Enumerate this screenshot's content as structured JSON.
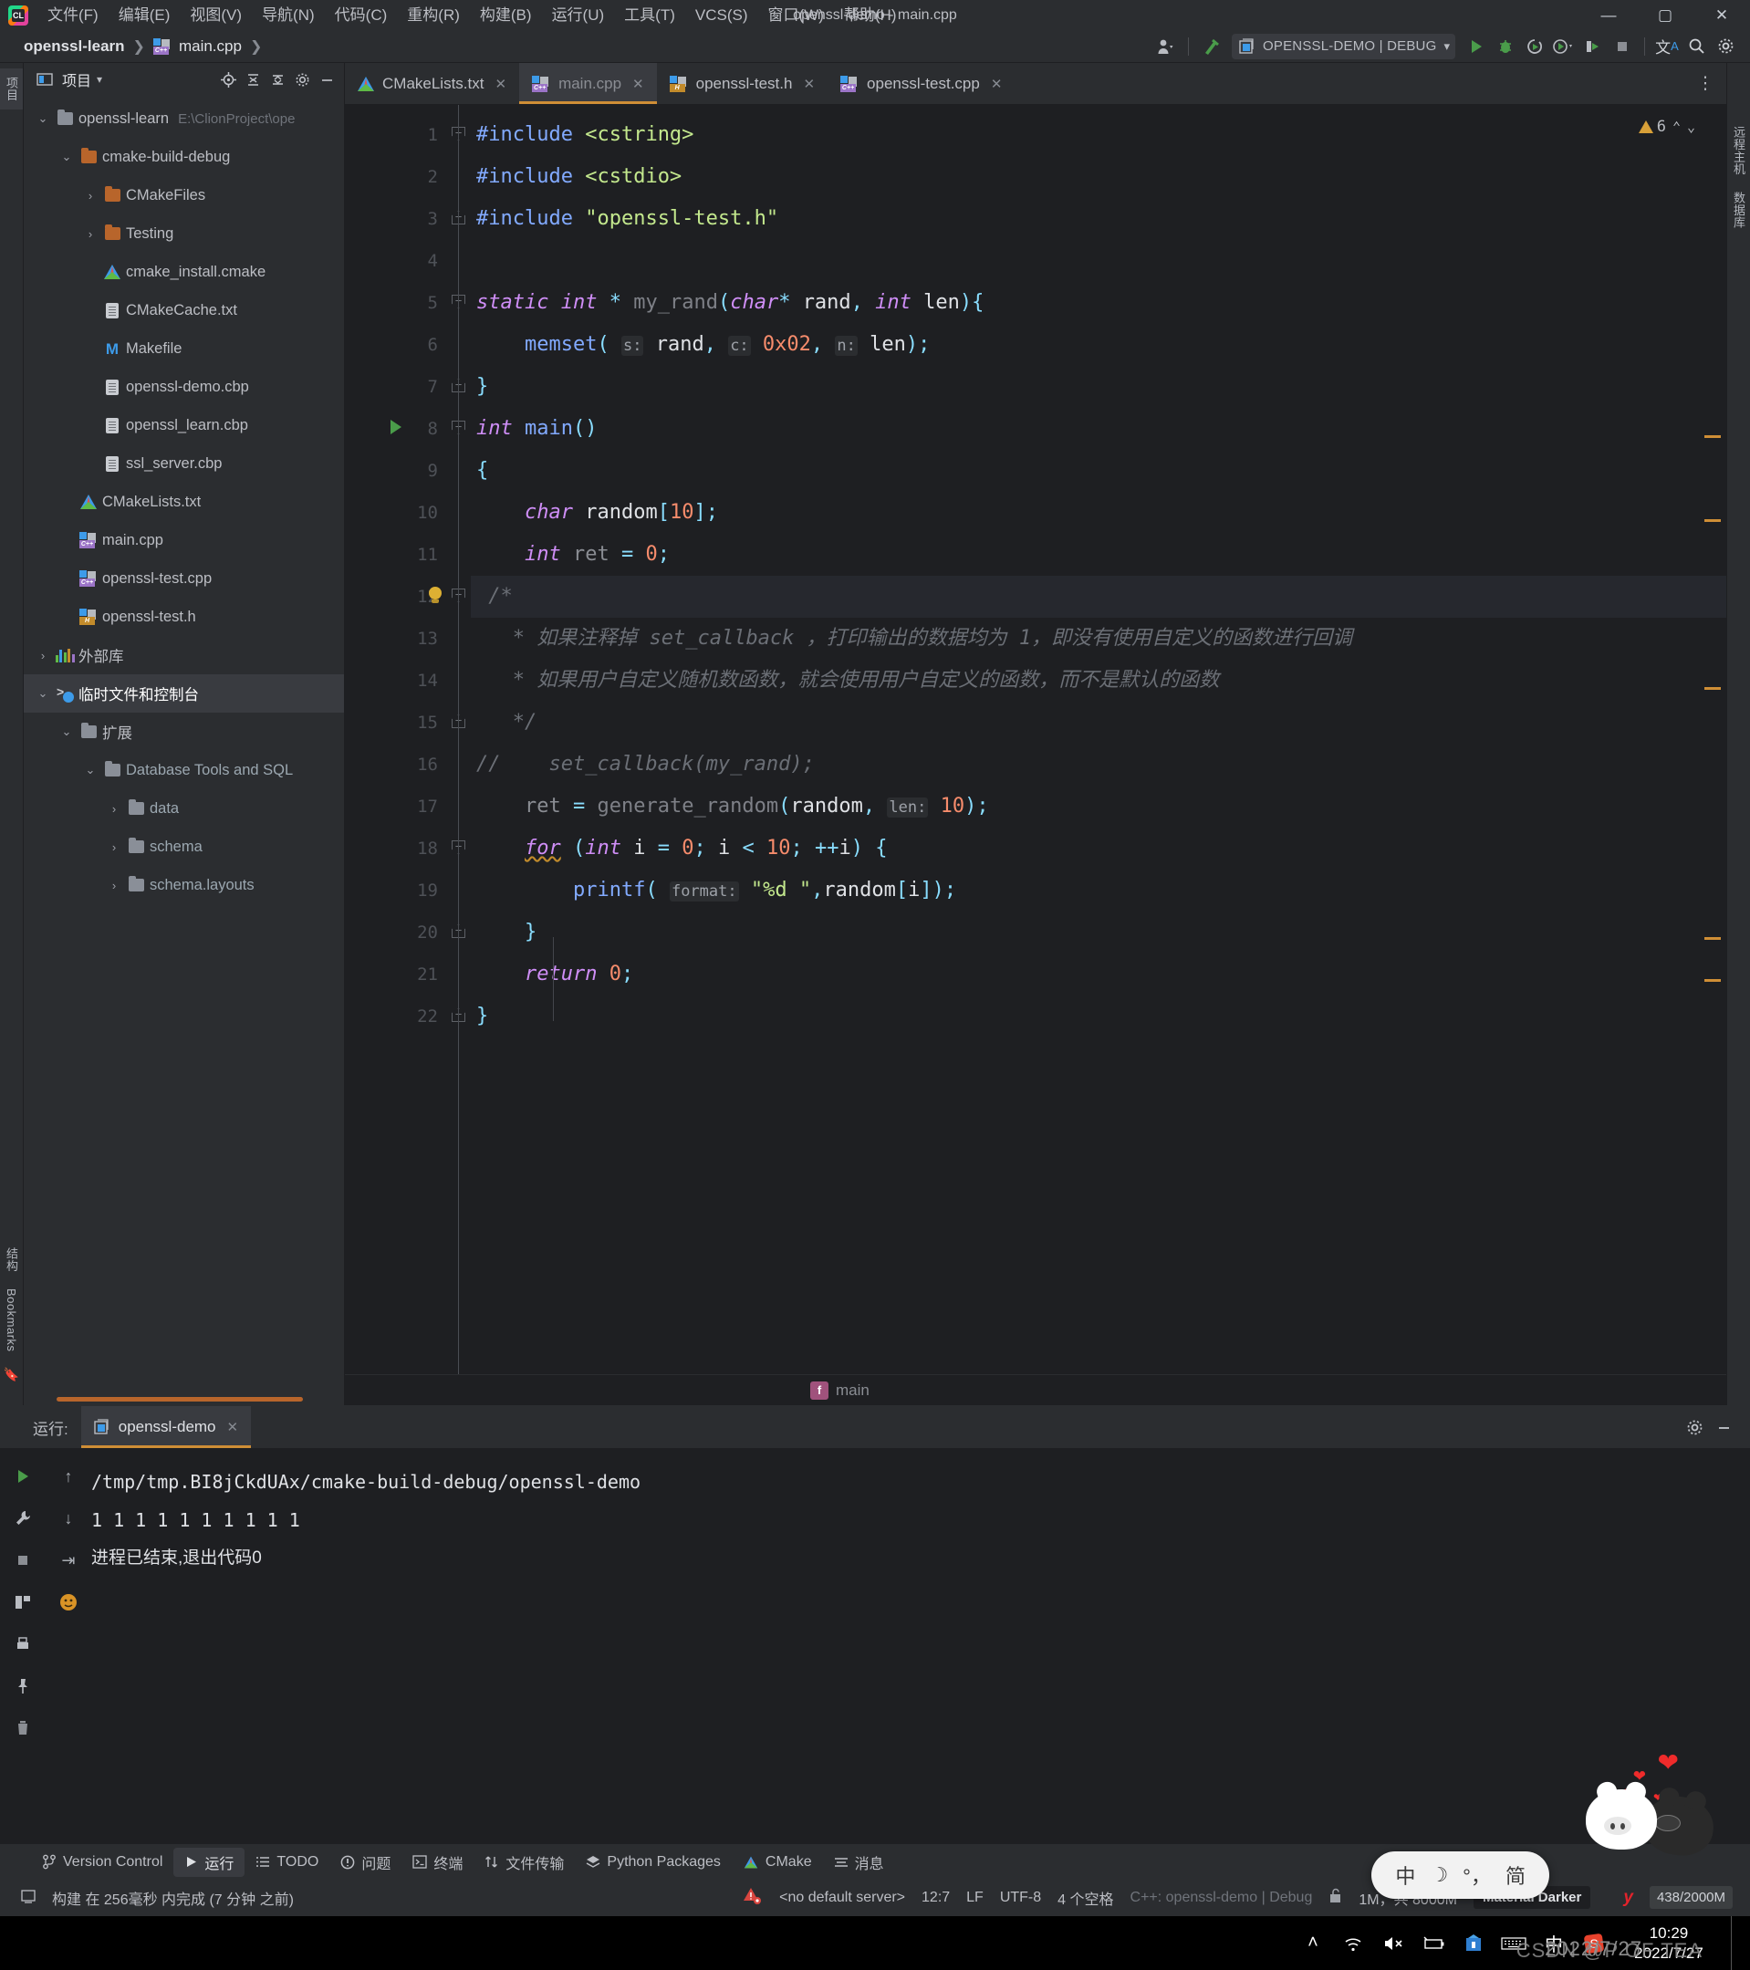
{
  "window": {
    "title": "openssl-demo - main.cpp",
    "minimize": "—",
    "maximize": "▢",
    "close": "✕"
  },
  "menu": [
    {
      "label": "文件(F)"
    },
    {
      "label": "编辑(E)"
    },
    {
      "label": "视图(V)"
    },
    {
      "label": "导航(N)"
    },
    {
      "label": "代码(C)"
    },
    {
      "label": "重构(R)"
    },
    {
      "label": "构建(B)"
    },
    {
      "label": "运行(U)"
    },
    {
      "label": "工具(T)"
    },
    {
      "label": "VCS(S)"
    },
    {
      "label": "窗口(W)"
    },
    {
      "label": "帮助(H)"
    }
  ],
  "navbar": {
    "crumbs": [
      "openssl-learn",
      "main.cpp"
    ],
    "separator": "❯",
    "run_configuration": "OPENSSL-DEMO | DEBUG",
    "icons": {
      "user": "user-icon",
      "build": "hammer-icon",
      "config": "run-config-icon",
      "dropdown": "▾",
      "run": "run-icon",
      "debug": "debug-icon",
      "run_with_coverage": "coverage-icon",
      "profile": "profile-icon",
      "attach": "attach-icon",
      "stop": "stop-icon",
      "translate": "translate-icon",
      "search": "search-icon",
      "settings": "gear-icon"
    }
  },
  "left_strip": {
    "project_tab": "项目",
    "structure_tab": "结构",
    "bookmarks_tab": "Bookmarks"
  },
  "right_strip": {
    "remote_host": "远程主机",
    "database": "数据库"
  },
  "project_panel": {
    "title": "项目",
    "dropdown": "▾",
    "actions": [
      "target-icon",
      "collapse-icon",
      "sort-icon",
      "gear-icon",
      "minimize-icon"
    ],
    "tree": [
      {
        "label": "openssl-learn",
        "path": "E:\\ClionProject\\ope",
        "icon": "folder-gray",
        "indent": 0,
        "twist": "⌄",
        "selected": false
      },
      {
        "label": "cmake-build-debug",
        "path": "",
        "icon": "folder-orange",
        "indent": 1,
        "twist": "⌄",
        "selected": false
      },
      {
        "label": "CMakeFiles",
        "path": "",
        "icon": "folder-orange",
        "indent": 2,
        "twist": "›",
        "selected": false
      },
      {
        "label": "Testing",
        "path": "",
        "icon": "folder-orange",
        "indent": 2,
        "twist": "›",
        "selected": false
      },
      {
        "label": "cmake_install.cmake",
        "path": "",
        "icon": "cmake-icon",
        "indent": 2,
        "twist": "",
        "selected": false
      },
      {
        "label": "CMakeCache.txt",
        "path": "",
        "icon": "doc-gear-icon",
        "indent": 2,
        "twist": "",
        "selected": false
      },
      {
        "label": "Makefile",
        "path": "",
        "icon": "makefile-icon",
        "indent": 2,
        "twist": "",
        "selected": false
      },
      {
        "label": "openssl-demo.cbp",
        "path": "",
        "icon": "doc-icon",
        "indent": 2,
        "twist": "",
        "selected": false
      },
      {
        "label": "openssl_learn.cbp",
        "path": "",
        "icon": "doc-icon",
        "indent": 2,
        "twist": "",
        "selected": false
      },
      {
        "label": "ssl_server.cbp",
        "path": "",
        "icon": "doc-icon",
        "indent": 2,
        "twist": "",
        "selected": false
      },
      {
        "label": "CMakeLists.txt",
        "path": "",
        "icon": "cmake-icon",
        "indent": 1,
        "twist": "",
        "selected": false
      },
      {
        "label": "main.cpp",
        "path": "",
        "icon": "cpp-icon",
        "indent": 1,
        "twist": "",
        "selected": false
      },
      {
        "label": "openssl-test.cpp",
        "path": "",
        "icon": "cpp-icon",
        "indent": 1,
        "twist": "",
        "selected": false
      },
      {
        "label": "openssl-test.h",
        "path": "",
        "icon": "h-icon",
        "indent": 1,
        "twist": "",
        "selected": false
      },
      {
        "label": "外部库",
        "path": "",
        "icon": "library-icon",
        "indent": 0,
        "twist": "›",
        "selected": false
      },
      {
        "label": "临时文件和控制台",
        "path": "",
        "icon": "console-icon",
        "indent": 0,
        "twist": "⌄",
        "selected": true
      },
      {
        "label": "扩展",
        "path": "",
        "icon": "folder-gray",
        "indent": 1,
        "twist": "⌄",
        "selected": false
      },
      {
        "label": "Database Tools and SQL",
        "path": "",
        "icon": "folder-gray",
        "indent": 2,
        "twist": "⌄",
        "selected": false,
        "blue": true
      },
      {
        "label": "data",
        "path": "",
        "icon": "folder-gray",
        "indent": 3,
        "twist": "›",
        "selected": false,
        "blue": true
      },
      {
        "label": "schema",
        "path": "",
        "icon": "folder-gray",
        "indent": 3,
        "twist": "›",
        "selected": false,
        "blue": true
      },
      {
        "label": "schema.layouts",
        "path": "",
        "icon": "folder-gray",
        "indent": 3,
        "twist": "›",
        "selected": false,
        "blue": true
      }
    ]
  },
  "editor": {
    "tabs": [
      {
        "label": "CMakeLists.txt",
        "icon": "cmake-icon",
        "active": false,
        "close": "✕"
      },
      {
        "label": "main.cpp",
        "icon": "cpp-icon",
        "active": true,
        "close": "✕"
      },
      {
        "label": "openssl-test.h",
        "icon": "h-icon",
        "active": false,
        "close": "✕"
      },
      {
        "label": "openssl-test.cpp",
        "icon": "cpp-icon",
        "active": false,
        "close": "✕"
      }
    ],
    "more_button": "⋮",
    "warning_count": "6",
    "nav_up": "⌃",
    "nav_down": "⌄",
    "line_numbers": [
      "1",
      "2",
      "3",
      "4",
      "5",
      "6",
      "7",
      "8",
      "9",
      "10",
      "11",
      "12",
      "13",
      "14",
      "15",
      "16",
      "17",
      "18",
      "19",
      "20",
      "21",
      "22"
    ],
    "code_lines": [
      "#include <cstring>",
      "#include <cstdio>",
      "#include \"openssl-test.h\"",
      "",
      "static int * my_rand(char* rand, int len){",
      "    memset( s: rand, c: 0x02, n: len);",
      "}",
      "int main()",
      "{",
      "    char random[10];",
      "    int ret = 0;",
      "    /*",
      "     * 如果注释掉 set_callback ，打印输出的数据均为 1，即没有使用自定义的函数进行回调",
      "     * 如果用户自定义随机数函数，就会使用用户自定义的函数，而不是默认的函数",
      "     */",
      "//    set_callback(my_rand);",
      "    ret = generate_random(random, len: 10);",
      "    for (int i = 0; i < 10; ++i) {",
      "        printf( format: \"%d \",random[i]);",
      "    }",
      "    return 0;",
      "}"
    ],
    "highlighted_line": 12,
    "breadcrumb_function": "main",
    "breadcrumb_badge": "f"
  },
  "run_panel": {
    "label": "运行:",
    "tab": "openssl-demo",
    "tab_close": "✕",
    "settings_icon": "gear-icon",
    "minimize_icon": "minimize-icon",
    "gutter_icons": [
      "rerun-icon",
      "wrench-icon",
      "stop-icon",
      "layout-icon",
      "print-icon",
      "pin-icon",
      "trash-icon",
      "scroll-up-icon",
      "scroll-down-icon",
      "soft-wrap-icon"
    ],
    "output": [
      "/tmp/tmp.BI8jCkdUAx/cmake-build-debug/openssl-demo",
      "1 1 1 1 1 1 1 1 1 1",
      "进程已结束,退出代码0"
    ]
  },
  "bottom_bar": [
    {
      "label": "Version Control",
      "icon": "branch-icon",
      "selected": false
    },
    {
      "label": "运行",
      "icon": "run-icon",
      "selected": true
    },
    {
      "label": "TODO",
      "icon": "list-icon",
      "selected": false
    },
    {
      "label": "问题",
      "icon": "problem-icon",
      "selected": false
    },
    {
      "label": "终端",
      "icon": "terminal-icon",
      "selected": false
    },
    {
      "label": "文件传输",
      "icon": "transfer-icon",
      "selected": false
    },
    {
      "label": "Python Packages",
      "icon": "packages-icon",
      "selected": false
    },
    {
      "label": "CMake",
      "icon": "cmake-icon",
      "selected": false
    },
    {
      "label": "消息",
      "icon": "message-icon",
      "selected": false
    }
  ],
  "status_bar": {
    "build_message": "构建 在 256毫秒 内完成 (7 分钟 之前)",
    "build_icon": "build-icon",
    "server_warning_icon": "server-error-icon",
    "server": "<no default server>",
    "caret": "12:7",
    "line_sep": "LF",
    "encoding": "UTF-8",
    "indent": "4 个空格",
    "toolchain": "C++: openssl-demo | Debug",
    "lock_icon": "unlock-icon",
    "heap": "1M，共 8000M",
    "theme": "Material Darker",
    "theme_dot": "orange-dot",
    "yandex_icon": "y-icon",
    "memory": "438/2000M"
  },
  "ime": {
    "mode": "中",
    "moon": "☽",
    "degree": "°，",
    "simplified": "简"
  },
  "taskbar": {
    "tray_icons": [
      "chevron-up-icon",
      "wifi-icon",
      "volume-mute-icon",
      "battery-icon",
      "store-icon",
      "keyboard-icon",
      "ime-cn-icon",
      "sogou-icon"
    ],
    "ime_label": "中",
    "time": "10:29",
    "date": "2022/7/27",
    "show_desktop": "show-desktop-button"
  },
  "watermarks": {
    "csdn": "CSDN @P OF TEA",
    "date": "2022/7/27"
  }
}
